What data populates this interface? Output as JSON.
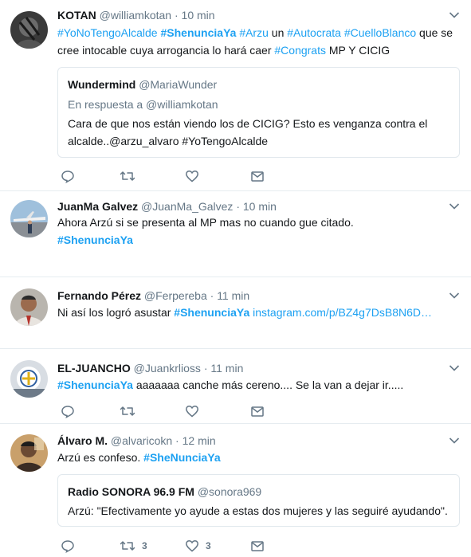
{
  "tweets": [
    {
      "name": "KOTAN",
      "handle": "@williamkotan",
      "dot": "·",
      "time": "10 min",
      "text": {
        "t1": "#YoNoTengoAlcalde",
        "t2": "#ShenunciaYa",
        "t3": "#Arzu",
        "s1": " un ",
        "t4": "#Autocrata",
        "t5": "#CuelloBlanco",
        "s2": " que se",
        "s3": "cree intocable cuya arrogancia lo hará caer ",
        "t6": "#Congrats",
        "s4": " MP Y CICIG"
      },
      "quote": {
        "name": "Wundermind",
        "handle": "@MariaWunder",
        "reply_note": "En respuesta a @williamkotan",
        "line1": "Cara de que nos están viendo los de CICIG?  Esto es venganza contra el",
        "line2": "alcalde..@arzu_alvaro  #YoTengoAlcalde"
      }
    },
    {
      "name": "JuanMa Galvez",
      "handle": "@JuanMa_Galvez",
      "dot": "·",
      "time": "10 min",
      "line1": "Ahora Arzú si se presenta al MP mas no cuando gue citado.",
      "tag": "#ShenunciaYa"
    },
    {
      "name": "Fernando Pérez",
      "handle": "@Ferpereba",
      "dot": "·",
      "time": "11 min",
      "text": "Ni así los logró asustar ",
      "tag": "#ShenunciaYa",
      "link": "instagram.com/p/BZ4g7DsB8N6D…"
    },
    {
      "name": "EL-JUANCHO",
      "handle": "@Juankrlioss",
      "dot": "·",
      "time": "11 min",
      "tag": "#ShenunciaYa",
      "text": " aaaaaaa canche más cereno....  Se la van a dejar ir....."
    },
    {
      "name": "Álvaro M.",
      "handle": "@alvaricokn",
      "dot": "·",
      "time": "12 min",
      "text": "Arzú es confeso. ",
      "tag": "#SheNunciaYa",
      "quote": {
        "name": "Radio SONORA 96.9 FM",
        "handle": "@sonora969",
        "line1": "Arzú: \"Efectivamente yo ayude a estas dos mujeres y las seguiré ayudando\"."
      },
      "retweets": "3",
      "likes": "3"
    }
  ],
  "colors": {
    "accent": "#1da1f2",
    "muted": "#657786",
    "border": "#e6ecf0"
  }
}
